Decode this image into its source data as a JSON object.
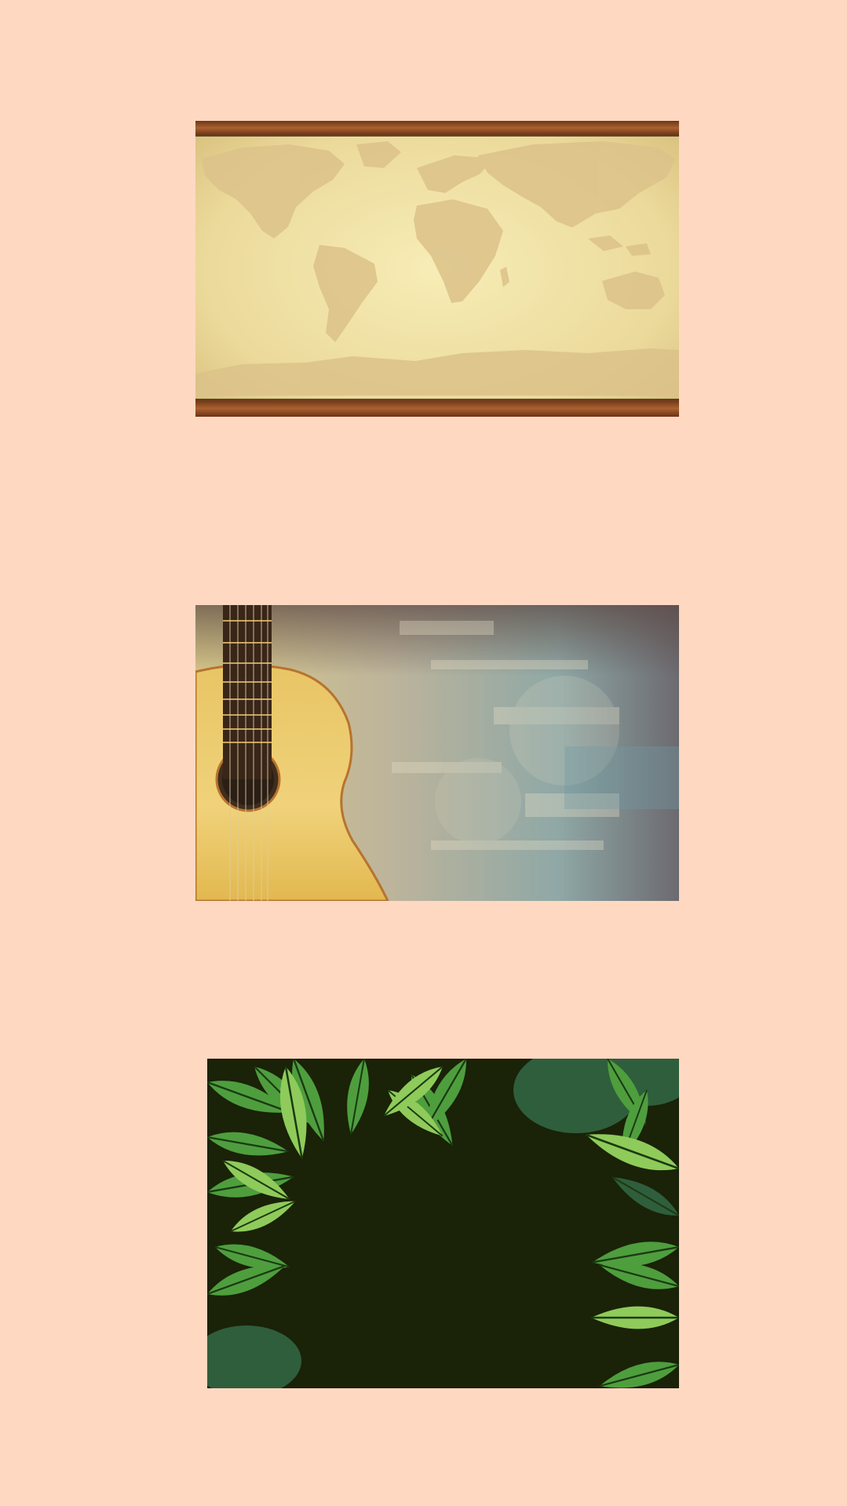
{
  "page": {
    "background_color": "#FFD8C2"
  },
  "gallery": {
    "items": [
      {
        "image": "world-map-parchment-banner",
        "colors": {
          "border": "#8B4A22",
          "paper": "#F1E4A6",
          "land": "#DCC289"
        }
      },
      {
        "image": "acoustic-guitar-grunge-background",
        "colors": {
          "body": "#E9C46A",
          "wood": "#B8732F",
          "neck": "#3A2618",
          "grunge_dark": "#7A6E62",
          "grunge_teal": "#6F9CA3"
        }
      },
      {
        "image": "tropical-leaves-frame",
        "colors": {
          "center": "#1A2208",
          "leaf_light": "#8FCB5A",
          "leaf_mid": "#4E9E3E",
          "leaf_dark": "#2F5E3C"
        }
      }
    ]
  }
}
